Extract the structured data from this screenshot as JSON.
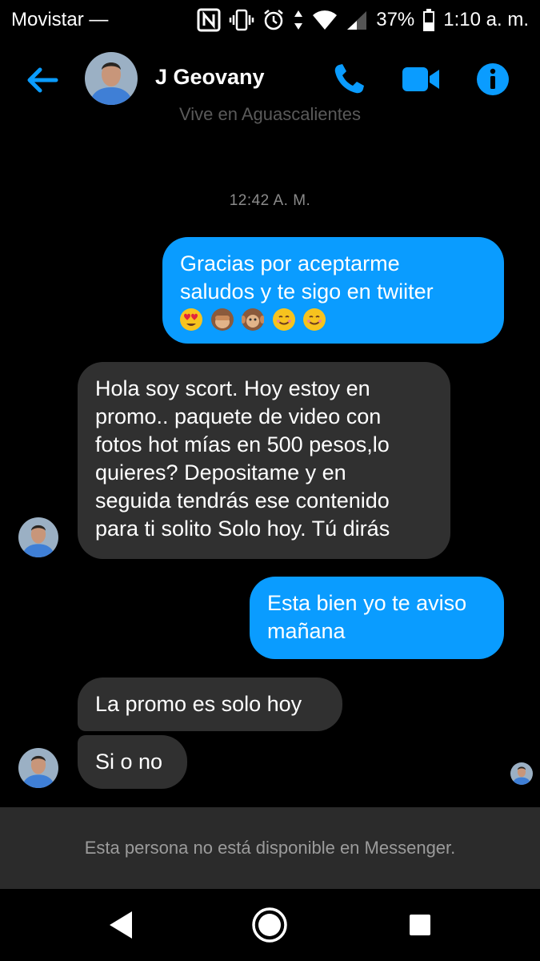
{
  "status_bar": {
    "carrier": "Movistar —",
    "battery": "37%",
    "time": "1:10 a. m."
  },
  "header": {
    "contact_name": "J Geovany",
    "subtitle": "Vive en Aguascalientes"
  },
  "conversation": {
    "timestamp": "12:42 A. M.",
    "messages": [
      {
        "direction": "outgoing",
        "lines": [
          "Gracias por aceptarme",
          "saludos y te sigo en twiiter"
        ],
        "emojis": [
          "heart-eyes-emoji",
          "see-no-evil-monkey-emoji",
          "hear-no-evil-monkey-emoji",
          "smiling-face-emoji",
          "smiling-face-emoji"
        ]
      },
      {
        "direction": "incoming",
        "lines": [
          "Hola soy scort. Hoy estoy en",
          "promo..  paquete de video con",
          "fotos hot mías en 500 pesos,lo",
          "quieres? Depositame y en",
          "seguida tendrás ese contenido",
          "para ti solito Solo hoy.  Tú dirás"
        ]
      },
      {
        "direction": "outgoing",
        "lines": [
          "Esta bien yo te aviso",
          "mañana"
        ]
      },
      {
        "direction": "incoming",
        "lines": [
          "La promo es solo hoy"
        ]
      },
      {
        "direction": "incoming",
        "lines": [
          "Si o no"
        ]
      }
    ]
  },
  "footer": {
    "unavailable_text": "Esta persona no está disponible en Messenger."
  },
  "colors": {
    "accent": "#0a9cff",
    "incoming_bubble": "#303030",
    "background": "#000000"
  }
}
